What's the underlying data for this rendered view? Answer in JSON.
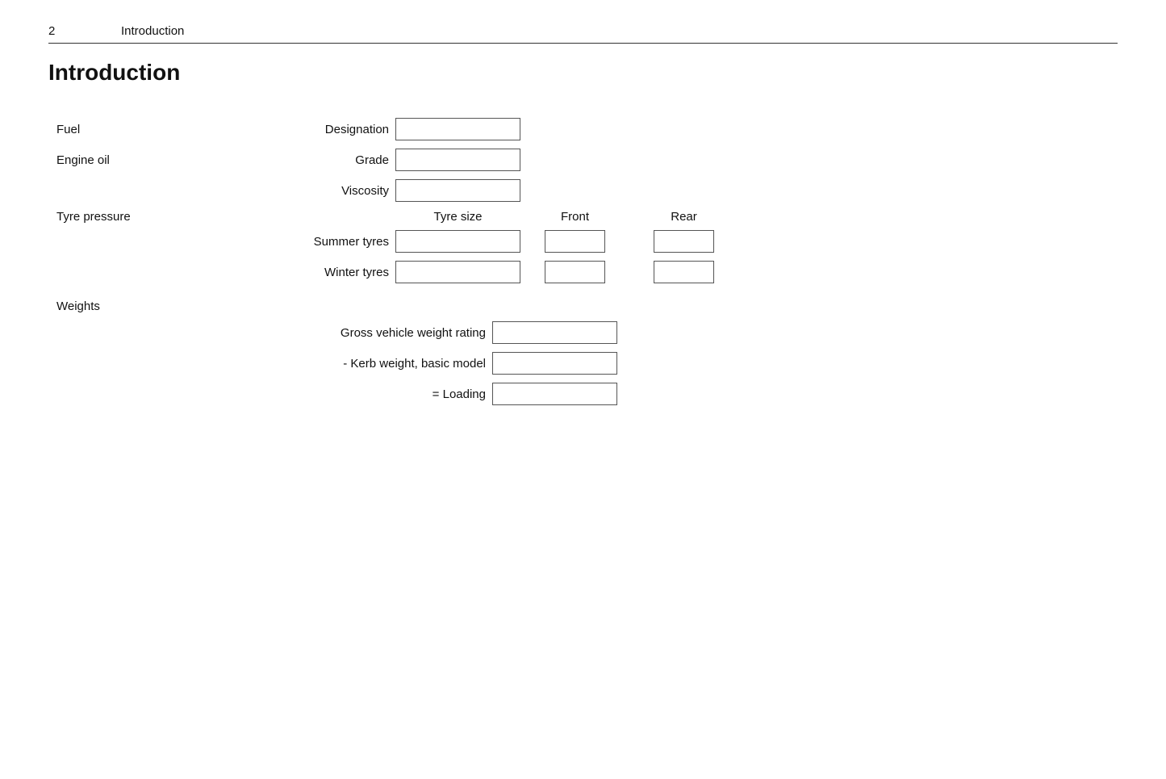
{
  "header": {
    "page_number": "2",
    "title": "Introduction"
  },
  "section": {
    "title": "Introduction"
  },
  "fuel": {
    "label": "Fuel",
    "designation_label": "Designation"
  },
  "engine_oil": {
    "label": "Engine oil",
    "grade_label": "Grade",
    "viscosity_label": "Viscosity"
  },
  "tyre_pressure": {
    "label": "Tyre pressure",
    "tyre_size_header": "Tyre size",
    "front_header": "Front",
    "rear_header": "Rear",
    "summer_tyres_label": "Summer tyres",
    "winter_tyres_label": "Winter tyres"
  },
  "weights": {
    "label": "Weights",
    "gross_vehicle_weight_label": "Gross vehicle weight rating",
    "kerb_weight_label": "- Kerb weight, basic model",
    "loading_label": "= Loading"
  }
}
